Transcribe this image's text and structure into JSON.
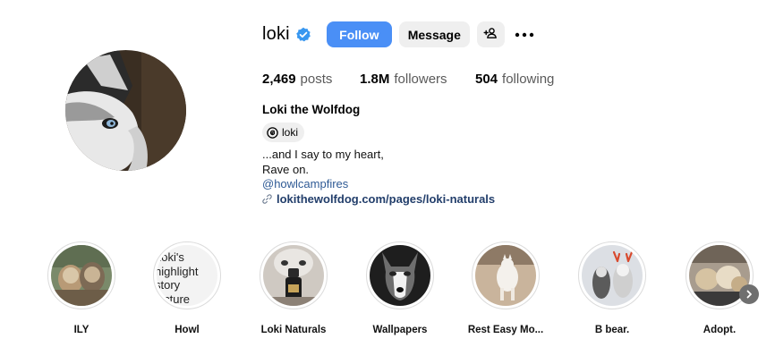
{
  "profile": {
    "username": "loki",
    "verified": true,
    "follow_label": "Follow",
    "message_label": "Message",
    "full_name": "Loki the Wolfdog",
    "threads_handle": "loki",
    "stats": {
      "posts_count": "2,469",
      "posts_label": "posts",
      "followers_count": "1.8M",
      "followers_label": "followers",
      "following_count": "504",
      "following_label": "following"
    },
    "bio": {
      "line1": "...and I say to my heart,",
      "line2": "Rave on.",
      "mention": "@howlcampfires",
      "link": "lokithewolfdog.com/pages/loki-naturals"
    },
    "colors": {
      "follow_button": "#4a8ff6",
      "secondary_button": "#efefef",
      "verified_badge": "#3897f0",
      "link": "#223e6b"
    }
  },
  "highlights": [
    {
      "label": "ILY",
      "image": "two-dogs-photo"
    },
    {
      "label": "Howl",
      "image": "text-picture",
      "picture_text": [
        "Loki's",
        "highlight",
        "story",
        "picture"
      ]
    },
    {
      "label": "Loki Naturals",
      "image": "product-bottle-photo"
    },
    {
      "label": "Wallpapers",
      "image": "husky-face-photo"
    },
    {
      "label": "Rest Easy Mo...",
      "image": "white-dog-walking-photo"
    },
    {
      "label": "B bear.",
      "image": "dogs-with-antlers-photo"
    },
    {
      "label": "Adopt.",
      "image": "puppies-photo"
    }
  ]
}
